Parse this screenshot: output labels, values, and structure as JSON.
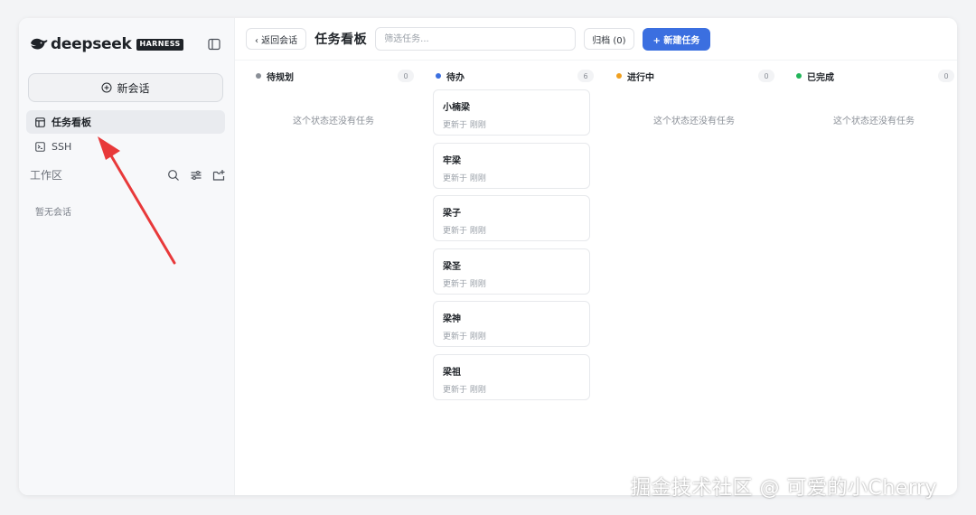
{
  "sidebar": {
    "brand": {
      "name": "deepseek",
      "tag": "HARNESS"
    },
    "new_chat_label": "新会话",
    "nav": [
      {
        "label": "任务看板",
        "icon": "board-icon",
        "active": true
      },
      {
        "label": "SSH",
        "icon": "terminal-icon",
        "active": false
      }
    ],
    "workspace": {
      "label": "工作区",
      "empty_text": "暂无会话"
    }
  },
  "toolbar": {
    "back_label": "‹ 返回会话",
    "title": "任务看板",
    "filter_placeholder": "筛选任务...",
    "archive_label": "归档 (0)",
    "new_task_label": "+ 新建任务"
  },
  "columns": [
    {
      "title": "待规划",
      "count": "0",
      "color": "#8a8f97",
      "empty_text": "这个状态还没有任务",
      "cards": []
    },
    {
      "title": "待办",
      "count": "6",
      "color": "#3b6fe0",
      "empty_text": "",
      "cards": [
        {
          "title": "小楠梁",
          "subtitle": "更新于 刚刚"
        },
        {
          "title": "牢梁",
          "subtitle": "更新于 刚刚"
        },
        {
          "title": "梁子",
          "subtitle": "更新于 刚刚"
        },
        {
          "title": "梁圣",
          "subtitle": "更新于 刚刚"
        },
        {
          "title": "梁神",
          "subtitle": "更新于 刚刚"
        },
        {
          "title": "梁祖",
          "subtitle": "更新于 刚刚"
        }
      ]
    },
    {
      "title": "进行中",
      "count": "0",
      "color": "#f0a020",
      "empty_text": "这个状态还没有任务",
      "cards": []
    },
    {
      "title": "已完成",
      "count": "0",
      "color": "#22b55a",
      "empty_text": "这个状态还没有任务",
      "cards": []
    }
  ],
  "watermark": "掘金技术社区 @ 可爱的小Cherry",
  "colors": {
    "accent": "#3b6fe0",
    "annotation_arrow": "#e8393a"
  }
}
